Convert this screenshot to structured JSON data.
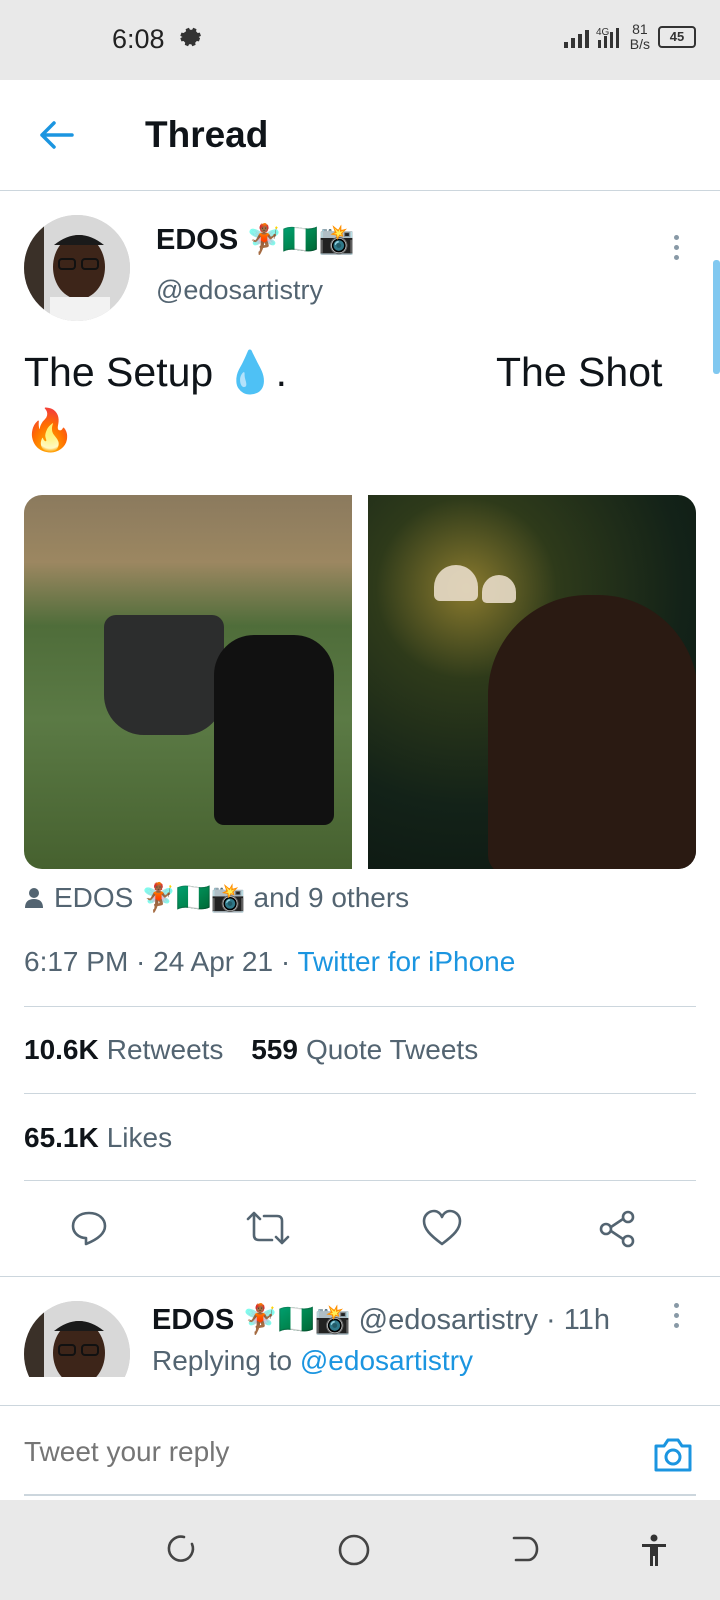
{
  "status_bar": {
    "time": "6:08",
    "network": "4G",
    "speed": "81\nB/s",
    "battery": "45"
  },
  "app_bar": {
    "title": "Thread"
  },
  "tweet": {
    "author_name": "EDOS 🧚🏾🇳🇬📸",
    "author_handle": "@edosartistry",
    "text_left": "The Setup 💧.",
    "text_right": "The Shot",
    "text_line2": "🔥",
    "retweeted_by": "EDOS 🧚🏾🇳🇬📸 and 9 others",
    "time": "6:17 PM",
    "date": "24 Apr 21",
    "source": "Twitter for iPhone",
    "retweets_count": "10.6K",
    "retweets_label": "Retweets",
    "quotes_count": "559",
    "quotes_label": "Quote Tweets",
    "likes_count": "65.1K",
    "likes_label": "Likes"
  },
  "reply": {
    "author_name": "EDOS 🧚🏾🇳🇬📸",
    "handle_time": "@edosartistry · 11h",
    "replying_prefix": "Replying to",
    "replying_handle": "@edosartistry"
  },
  "compose": {
    "placeholder": "Tweet your reply"
  },
  "colors": {
    "accent": "#1b95e0",
    "text": "#0f1419",
    "secondary": "#536471"
  }
}
